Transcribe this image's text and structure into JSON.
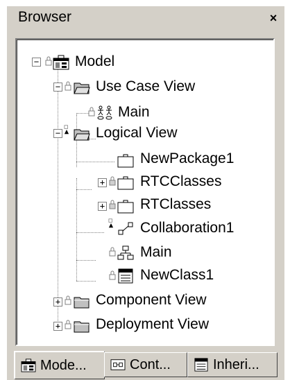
{
  "window": {
    "title": "Browser",
    "close_glyph": "×"
  },
  "tree": {
    "model": "Model",
    "use_case_view": "Use Case View",
    "use_case_main": "Main",
    "logical_view": "Logical View",
    "new_package": "NewPackage1",
    "rtc_classes": "RTCClasses",
    "rt_classes": "RTClasses",
    "collaboration": "Collaboration1",
    "logical_main": "Main",
    "new_class": "NewClass1",
    "component_view": "Component View",
    "deployment_view": "Deployment View"
  },
  "tabs": [
    {
      "label": "Mode...",
      "icon": "model-tab-icon",
      "active": true
    },
    {
      "label": "Cont...",
      "icon": "containment-tab-icon",
      "active": false
    },
    {
      "label": "Inheri...",
      "icon": "inheritance-tab-icon",
      "active": false
    }
  ]
}
